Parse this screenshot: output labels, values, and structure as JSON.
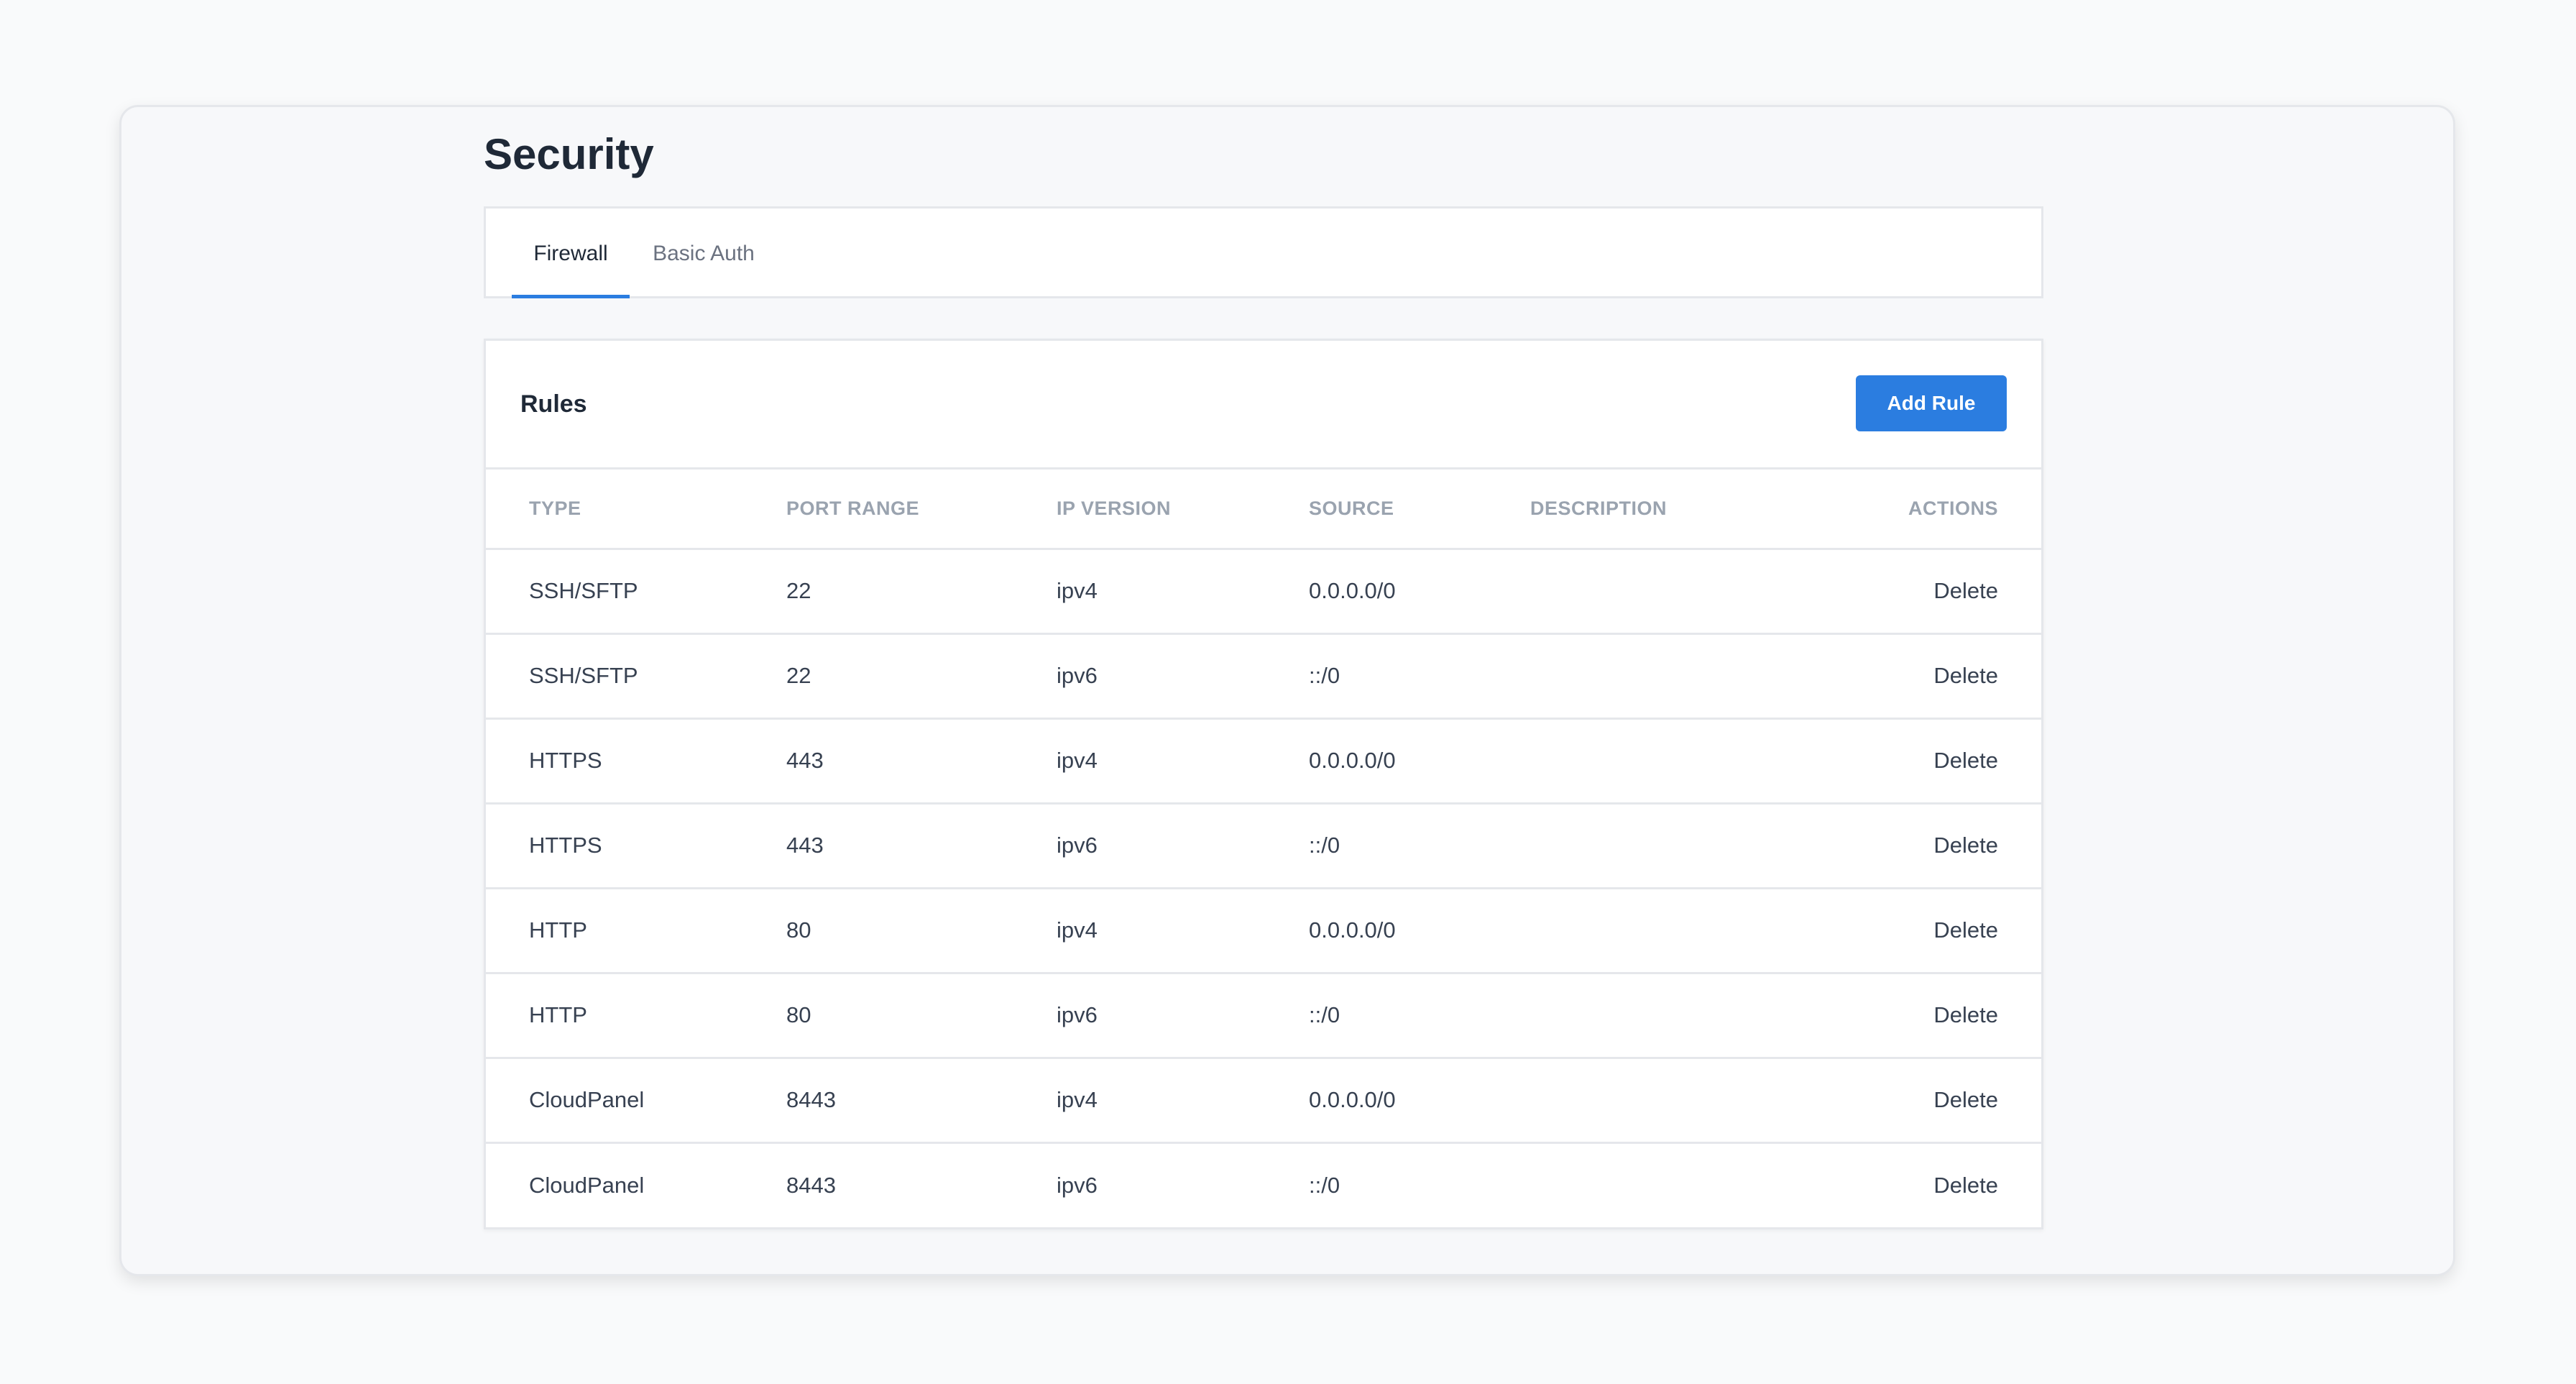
{
  "page": {
    "title": "Security"
  },
  "tabs": [
    {
      "label": "Firewall",
      "active": true
    },
    {
      "label": "Basic Auth",
      "active": false
    }
  ],
  "rules": {
    "title": "Rules",
    "add_button_label": "Add Rule",
    "columns": {
      "type": "TYPE",
      "port_range": "PORT RANGE",
      "ip_version": "IP VERSION",
      "source": "SOURCE",
      "description": "DESCRIPTION",
      "actions": "ACTIONS"
    },
    "rows": [
      {
        "type": "SSH/SFTP",
        "port_range": "22",
        "ip_version": "ipv4",
        "source": "0.0.0.0/0",
        "description": "",
        "action": "Delete"
      },
      {
        "type": "SSH/SFTP",
        "port_range": "22",
        "ip_version": "ipv6",
        "source": "::/0",
        "description": "",
        "action": "Delete"
      },
      {
        "type": "HTTPS",
        "port_range": "443",
        "ip_version": "ipv4",
        "source": "0.0.0.0/0",
        "description": "",
        "action": "Delete"
      },
      {
        "type": "HTTPS",
        "port_range": "443",
        "ip_version": "ipv6",
        "source": "::/0",
        "description": "",
        "action": "Delete"
      },
      {
        "type": "HTTP",
        "port_range": "80",
        "ip_version": "ipv4",
        "source": "0.0.0.0/0",
        "description": "",
        "action": "Delete"
      },
      {
        "type": "HTTP",
        "port_range": "80",
        "ip_version": "ipv6",
        "source": "::/0",
        "description": "",
        "action": "Delete"
      },
      {
        "type": "CloudPanel",
        "port_range": "8443",
        "ip_version": "ipv4",
        "source": "0.0.0.0/0",
        "description": "",
        "action": "Delete"
      },
      {
        "type": "CloudPanel",
        "port_range": "8443",
        "ip_version": "ipv6",
        "source": "::/0",
        "description": "",
        "action": "Delete"
      }
    ]
  },
  "colors": {
    "accent": "#2b7de0",
    "background": "#f9fafb",
    "border": "#e5e7eb",
    "header_text": "#9aa3af"
  }
}
